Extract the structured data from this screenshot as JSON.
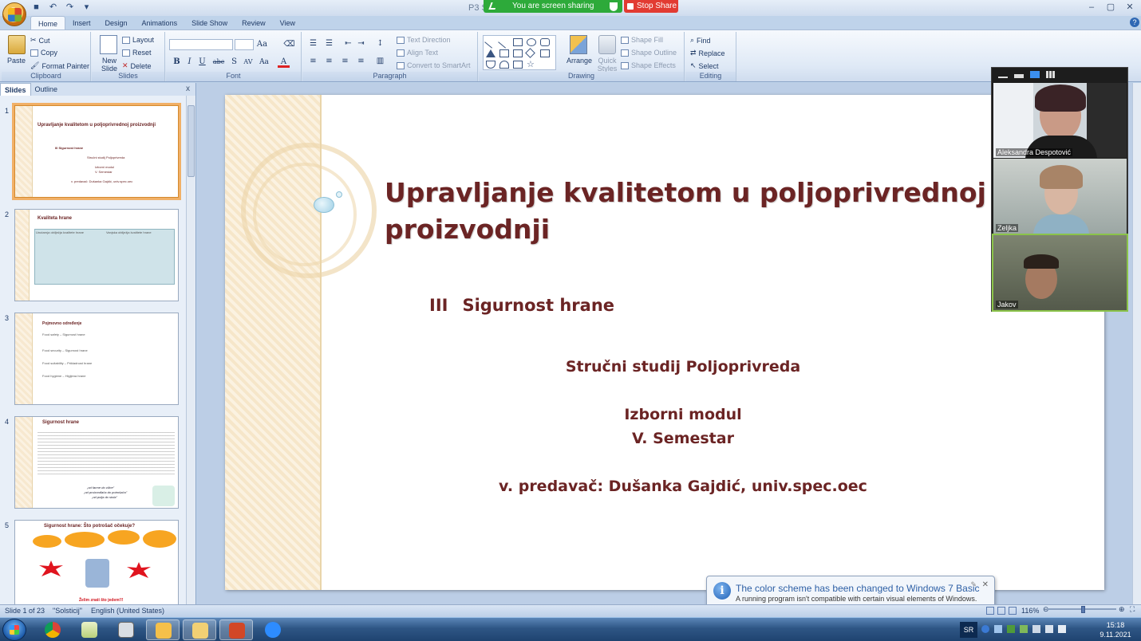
{
  "window": {
    "doc_title": "P3 S",
    "share_status": "You are screen sharing",
    "stop_share": "Stop Share",
    "controls": [
      "–",
      "▢",
      "✕"
    ]
  },
  "ribbon_tabs": [
    "Home",
    "Insert",
    "Design",
    "Animations",
    "Slide Show",
    "Review",
    "View"
  ],
  "ribbon": {
    "clipboard": {
      "label": "Clipboard",
      "paste": "Paste",
      "cut": "Cut",
      "copy": "Copy",
      "format_painter": "Format Painter"
    },
    "slides": {
      "label": "Slides",
      "new_slide": "New Slide",
      "layout": "Layout",
      "reset": "Reset",
      "delete": "Delete"
    },
    "font": {
      "label": "Font",
      "buttons": [
        "B",
        "I",
        "U",
        "abc",
        "S",
        "AV",
        "Aa",
        "A"
      ]
    },
    "paragraph": {
      "label": "Paragraph",
      "text_direction": "Text Direction",
      "align_text": "Align Text",
      "convert_smartart": "Convert to SmartArt"
    },
    "drawing": {
      "label": "Drawing",
      "arrange": "Arrange",
      "quick_styles": "Quick Styles",
      "shape_fill": "Shape Fill",
      "shape_outline": "Shape Outline",
      "shape_effects": "Shape Effects"
    },
    "editing": {
      "label": "Editing",
      "find": "Find",
      "replace": "Replace",
      "select": "Select"
    }
  },
  "pane": {
    "tab_slides": "Slides",
    "tab_outline": "Outline",
    "close": "x",
    "thumbnails": [
      {
        "num": "1",
        "title": "Upravljanje kvalitetom u poljoprivrednoj proizvodnji",
        "lines": [
          "III  Sigurnost hrane",
          "Stručni studij  Poljoprivreda",
          "Izborni modul",
          "V. Semestar",
          "v. predavač: Dušanka Gajdić, univ.spec.oec"
        ]
      },
      {
        "num": "2",
        "title": "Kvaliteta hrane",
        "lines": [
          "Unutarnja obilježja kvalitete hrane",
          "Vanjska obilježja kvalitete hrane"
        ]
      },
      {
        "num": "3",
        "title": "Pojmovno određenje",
        "lines": [
          "Food safety – Sigurnost hrane",
          "Food security – Sigurnost hrane",
          "Food suitability – Prikladnost hrane",
          "Food hygiene – Higijena hrane"
        ]
      },
      {
        "num": "4",
        "title": "Sigurnost hrane",
        "lines": [
          "„od farme do vilice\"",
          "„od proizvođača do potrošača\"",
          "„od polja do stola\""
        ]
      },
      {
        "num": "5",
        "title": "Sigurnost hrane: Što potrošač očekuje?",
        "lines": [
          "Želim znati što jedem!!!"
        ]
      }
    ]
  },
  "slide": {
    "title": "Upravljanje kvalitetom u poljoprivrednoj proizvodnji",
    "sub_num": "III",
    "sub_text": "Sigurnost hrane",
    "study": "Stručni studij Poljoprivreda",
    "module": "Izborni modul",
    "semester": "V. Semestar",
    "lecturer": "v. predavač: Dušanka Gajdić, univ.spec.oec"
  },
  "zoom": {
    "participants": [
      "Aleksandra Despotović",
      "Zeljka",
      "Jakov"
    ]
  },
  "notification": {
    "title": "The color scheme has been changed to Windows 7 Basic",
    "text": "A running program isn't compatible with certain visual elements of Windows. Click here for more information."
  },
  "status": {
    "slide": "Slide 1 of 23",
    "theme": "\"Solsticij\"",
    "language": "English (United States)",
    "zoom": "116%"
  },
  "taskbar": {
    "lang": "SR",
    "time": "15:18",
    "date": "9.11.2021"
  }
}
